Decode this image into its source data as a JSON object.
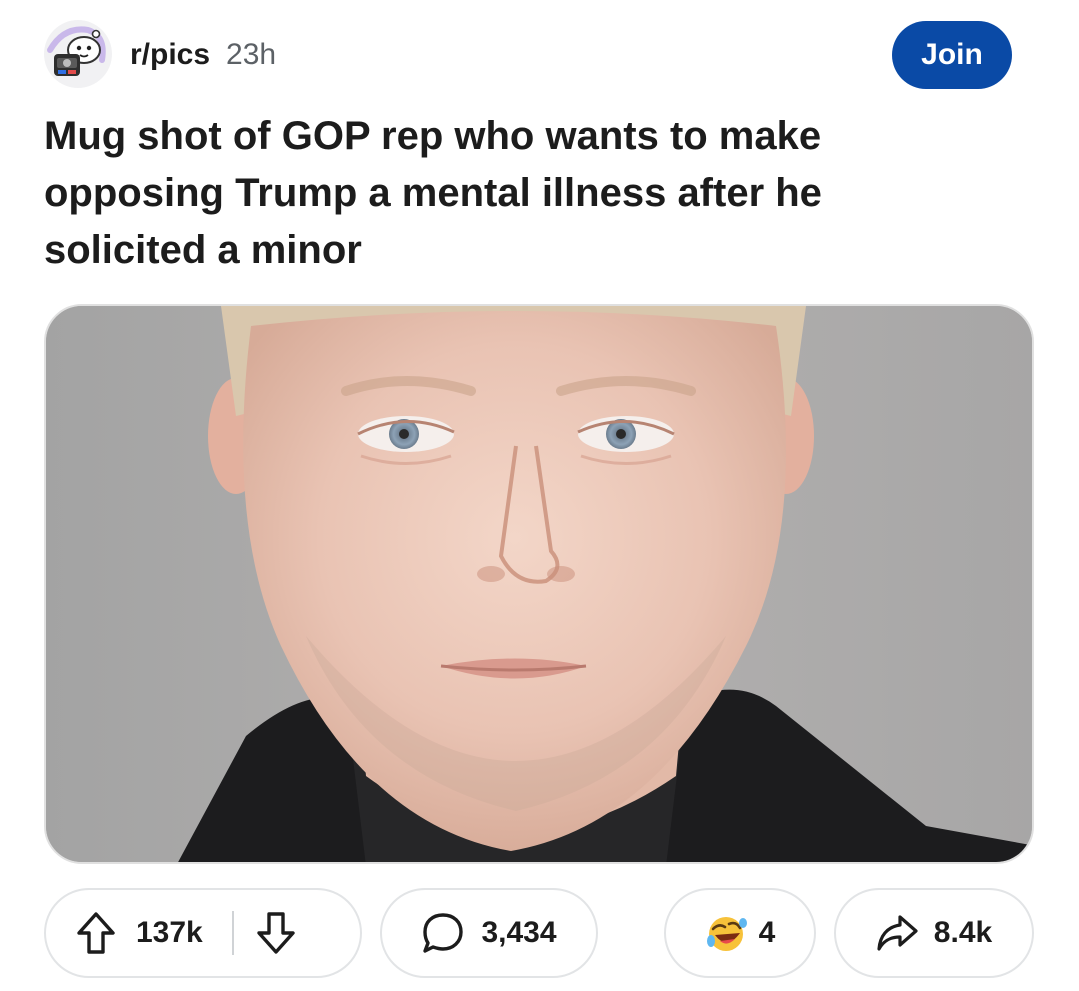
{
  "post": {
    "subreddit": "r/pics",
    "time_ago": "23h",
    "join_label": "Join",
    "title": "Mug shot of GOP rep who wants to make opposing Trump a mental illness after he solicited a minor"
  },
  "actions": {
    "upvotes": "137k",
    "comments": "3,434",
    "awards": "4",
    "shares": "8.4k"
  },
  "colors": {
    "join_bg": "#0a4aa6",
    "text": "#1c1c1c",
    "muted": "#5c6166",
    "pill_border": "#e2e4e6"
  },
  "icons": [
    "subreddit-avatar-icon",
    "upvote-arrow-icon",
    "downvote-arrow-icon",
    "comment-bubble-icon",
    "laughing-award-icon",
    "share-arrow-icon"
  ]
}
